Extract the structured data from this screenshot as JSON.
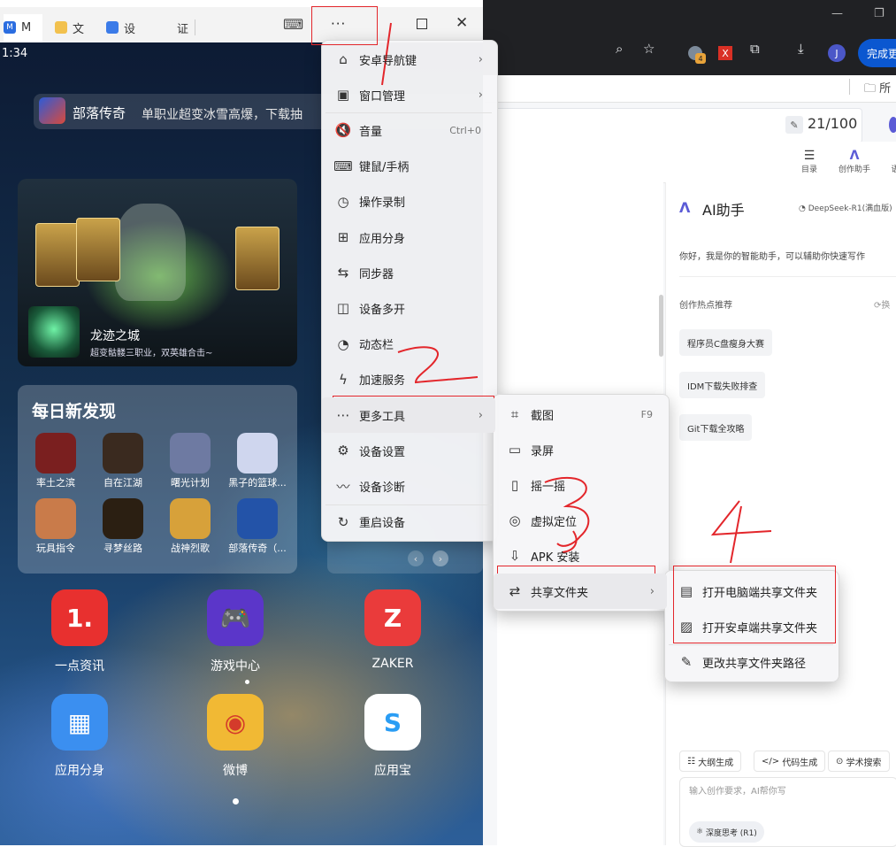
{
  "colors": {
    "accent": "#0b57d0",
    "annotation_red": "#e3262b",
    "ai_purple": "#5b5bd6"
  },
  "emulator": {
    "tabs": [
      {
        "label": "M",
        "icon": "app-logo-icon"
      },
      {
        "label": "文",
        "icon": "folder-icon"
      },
      {
        "label": "设",
        "icon": "settings-icon"
      },
      {
        "label": "证",
        "icon": ""
      }
    ],
    "more_button": "···",
    "time": "1:34",
    "marquee": {
      "name": "部落传奇",
      "desc": "单职业超变冰雪高爆，下载抽"
    },
    "featured_game": {
      "name": "龙迹之城",
      "desc": "超变骷髅三职业，双英雄合击~"
    },
    "daily": {
      "title": "每日新发现",
      "apps": [
        "率土之滨",
        "自在江湖",
        "曙光计划",
        "黑子的篮球...",
        "玩具指令",
        "寻梦丝路",
        "战神烈歌",
        "部落传奇（..."
      ]
    },
    "home_apps": [
      {
        "label": "一点资讯",
        "glyph": "1."
      },
      {
        "label": "游戏中心",
        "glyph": "🎮"
      },
      {
        "label": "ZAKER",
        "glyph": "Z"
      },
      {
        "label": "应用分身",
        "glyph": "▦"
      },
      {
        "label": "微博",
        "glyph": "◉"
      },
      {
        "label": "应用宝",
        "glyph": "S"
      }
    ]
  },
  "main_menu": {
    "items": [
      {
        "label": "安卓导航键",
        "icon": "nav-keys-icon",
        "glyph": "⌂",
        "arrow": "›"
      },
      {
        "label": "窗口管理",
        "icon": "window-icon",
        "glyph": "▣",
        "arrow": "›"
      },
      {
        "label": "音量",
        "icon": "volume-mute-icon",
        "glyph": "🔇",
        "shortcut": "Ctrl+0"
      },
      {
        "label": "键鼠/手柄",
        "icon": "keyboard-icon",
        "glyph": "⌨"
      },
      {
        "label": "操作录制",
        "icon": "record-icon",
        "glyph": "◷"
      },
      {
        "label": "应用分身",
        "icon": "app-clone-icon",
        "glyph": "⊞"
      },
      {
        "label": "同步器",
        "icon": "sync-icon",
        "glyph": "⇆"
      },
      {
        "label": "设备多开",
        "icon": "multi-instance-icon",
        "glyph": "◫"
      },
      {
        "label": "动态栏",
        "icon": "dynamic-bar-icon",
        "glyph": "◔"
      },
      {
        "label": "加速服务",
        "icon": "speed-icon",
        "glyph": "ϟ"
      },
      {
        "label": "更多工具",
        "icon": "more-tools-icon",
        "glyph": "⋯",
        "arrow": "›"
      },
      {
        "label": "设备设置",
        "icon": "device-settings-icon",
        "glyph": "⚙"
      },
      {
        "label": "设备诊断",
        "icon": "diagnose-icon",
        "glyph": "〰"
      },
      {
        "label": "重启设备",
        "icon": "restart-icon",
        "glyph": "↻"
      }
    ]
  },
  "tools_menu": {
    "items": [
      {
        "label": "截图",
        "icon": "screenshot-icon",
        "glyph": "⌗",
        "shortcut": "F9"
      },
      {
        "label": "录屏",
        "icon": "screen-record-icon",
        "glyph": "▭"
      },
      {
        "label": "摇一摇",
        "icon": "shake-icon",
        "glyph": "▯"
      },
      {
        "label": "虚拟定位",
        "icon": "location-icon",
        "glyph": "◎"
      },
      {
        "label": "APK 安装",
        "icon": "apk-install-icon",
        "glyph": "⇩"
      },
      {
        "label": "共享文件夹",
        "icon": "shared-folder-icon",
        "glyph": "⇄",
        "arrow": "›"
      }
    ]
  },
  "share_menu": {
    "items": [
      {
        "label": "打开电脑端共享文件夹",
        "icon": "pc-folder-icon",
        "glyph": "▤"
      },
      {
        "label": "打开安卓端共享文件夹",
        "icon": "android-folder-icon",
        "glyph": "▨"
      },
      {
        "label": "更改共享文件夹路径",
        "icon": "pencil-icon",
        "glyph": "✎"
      }
    ]
  },
  "annotations": [
    "1",
    "2",
    "3",
    "4"
  ],
  "browser": {
    "done_button": "完成更",
    "bookmark_folder": "所",
    "profile_initial": "J",
    "ext_badge": "4",
    "ext_red": "X"
  },
  "editor": {
    "counter": "21/100",
    "toolbar": [
      {
        "label": "目录"
      },
      {
        "label": "创作助手"
      },
      {
        "label": "语"
      }
    ]
  },
  "ai": {
    "title": "AI助手",
    "model": "DeepSeek-R1(满血版)",
    "greeting": "你好，我是你的智能助手，可以辅助你快速写作",
    "hot_label": "创作热点推荐",
    "switch_label": "换",
    "topics": [
      "程序员C盘瘦身大赛",
      "IDM下载失败排查",
      "Git下载全攻略"
    ],
    "quick": [
      "大纲生成",
      "代码生成",
      "学术搜索"
    ],
    "input_placeholder": "输入创作要求，AI帮你写",
    "deep_think": "深度思考 (R1)"
  }
}
